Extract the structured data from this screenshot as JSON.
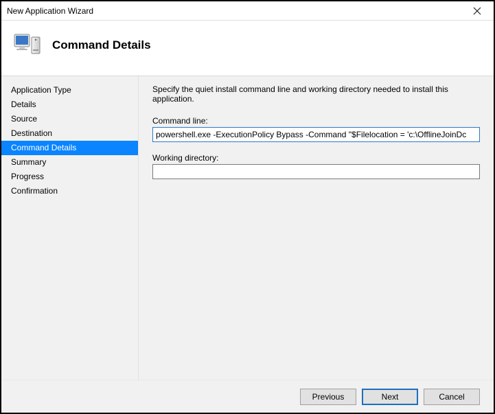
{
  "window": {
    "title": "New Application Wizard"
  },
  "header": {
    "heading": "Command Details"
  },
  "sidebar": {
    "items": [
      {
        "label": "Application Type"
      },
      {
        "label": "Details"
      },
      {
        "label": "Source"
      },
      {
        "label": "Destination"
      },
      {
        "label": "Command Details"
      },
      {
        "label": "Summary"
      },
      {
        "label": "Progress"
      },
      {
        "label": "Confirmation"
      }
    ],
    "selected_index": 4
  },
  "main": {
    "description": "Specify the quiet install command line and working directory needed to install this application.",
    "command_line": {
      "label": "Command line:",
      "value": "powershell.exe -ExecutionPolicy Bypass -Command \"$Filelocation = 'c:\\OfflineJoinDc"
    },
    "working_directory": {
      "label": "Working directory:",
      "value": ""
    }
  },
  "footer": {
    "previous": "Previous",
    "next": "Next",
    "cancel": "Cancel"
  }
}
